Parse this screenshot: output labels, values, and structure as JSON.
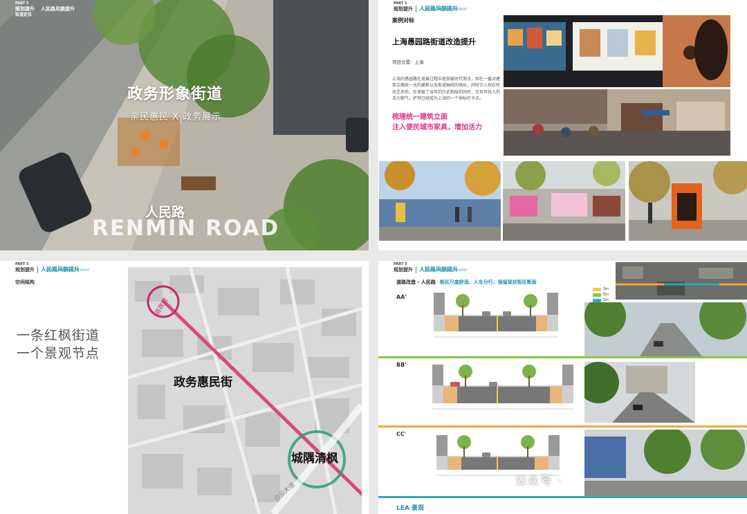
{
  "page1": {
    "title": "政务形象街道",
    "subtitle": "亲民惠民 X 政务展示",
    "road_cn": "人民路",
    "road_en": "RENMIN ROAD",
    "header_part": "PART 3",
    "header_cat": "规划提升",
    "header_topic": "人民路风貌提升",
    "header_sub": "街道定位"
  },
  "page2": {
    "header_part": "PART 3",
    "header_cat": "规划提升",
    "header_topic": "人民路风貌提升",
    "header_en": "LANDSCAPE IMPROVEMENT",
    "case_label": "案例对标",
    "title": "上海愚园路街道改造提升",
    "location": "项目位置：上海",
    "body": "上海的愚园路在发展过程中逐渐被时代淘汰，但在一番对建筑立面统一化的更新以及街道轴线的强化，同时引入现在时尚艺术后，在保留了当年的历史韵味的同时，又有年轻人的活力朝气，俨然已经成为上海的一个地标打卡点。",
    "highlight_1": "梳理统一建筑立面",
    "highlight_2": "注入便民城市家具，增加活力"
  },
  "page3": {
    "header_part": "PART 3",
    "header_cat": "规划提升",
    "header_topic": "人民路风貌提升",
    "header_en": "LANDSCAPE IMPROVEMENT",
    "label": "空间结构",
    "slogan_1": "一条红枫街道",
    "slogan_2": "一个景观节点",
    "map_label_main": "政务惠民街",
    "map_label_node": "城隅清枫",
    "map_label_top": "县政府",
    "map_label_road": "白云大道"
  },
  "page4": {
    "header_part": "PART 3",
    "header_cat": "规划提升",
    "header_topic": "人民路风貌提升",
    "header_en": "LANDSCAPE IMPROVEMENT",
    "title": "道路改造 - 人民路",
    "subtitle": "街区尺度舒适、人车分行、保留现状街区断面",
    "sections": [
      "AA'",
      "BB'",
      "CC'"
    ],
    "legend": [
      "3m",
      "5m",
      "3m"
    ],
    "footer": "LEA 景观",
    "watermark": "公众号 ·"
  },
  "colors": {
    "accent": "#1f8fb0",
    "pink": "#e0338a",
    "green_band": "#8cc63f",
    "orange_band": "#f3a73b",
    "teal_band": "#31a8b8"
  }
}
